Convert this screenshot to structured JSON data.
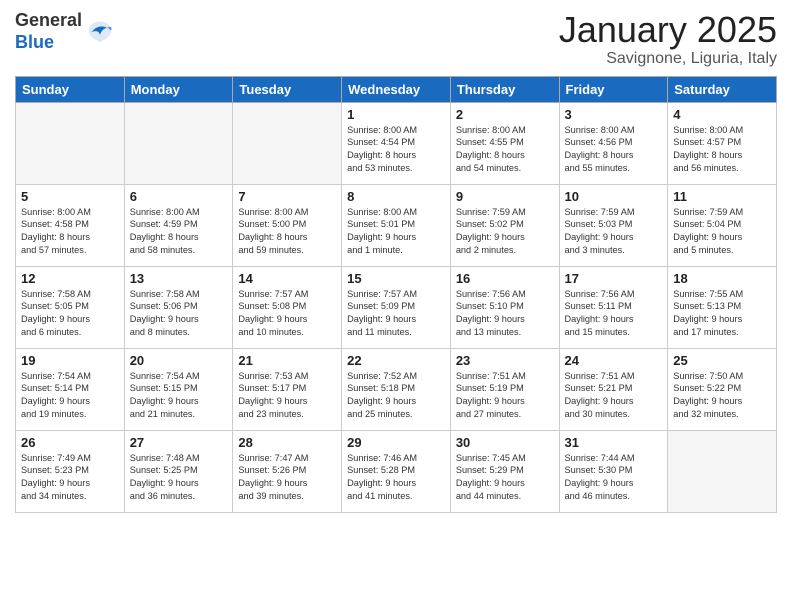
{
  "header": {
    "logo_general": "General",
    "logo_blue": "Blue",
    "month_title": "January 2025",
    "location": "Savignone, Liguria, Italy"
  },
  "weekdays": [
    "Sunday",
    "Monday",
    "Tuesday",
    "Wednesday",
    "Thursday",
    "Friday",
    "Saturday"
  ],
  "weeks": [
    [
      {
        "day": "",
        "info": ""
      },
      {
        "day": "",
        "info": ""
      },
      {
        "day": "",
        "info": ""
      },
      {
        "day": "1",
        "info": "Sunrise: 8:00 AM\nSunset: 4:54 PM\nDaylight: 8 hours\nand 53 minutes."
      },
      {
        "day": "2",
        "info": "Sunrise: 8:00 AM\nSunset: 4:55 PM\nDaylight: 8 hours\nand 54 minutes."
      },
      {
        "day": "3",
        "info": "Sunrise: 8:00 AM\nSunset: 4:56 PM\nDaylight: 8 hours\nand 55 minutes."
      },
      {
        "day": "4",
        "info": "Sunrise: 8:00 AM\nSunset: 4:57 PM\nDaylight: 8 hours\nand 56 minutes."
      }
    ],
    [
      {
        "day": "5",
        "info": "Sunrise: 8:00 AM\nSunset: 4:58 PM\nDaylight: 8 hours\nand 57 minutes."
      },
      {
        "day": "6",
        "info": "Sunrise: 8:00 AM\nSunset: 4:59 PM\nDaylight: 8 hours\nand 58 minutes."
      },
      {
        "day": "7",
        "info": "Sunrise: 8:00 AM\nSunset: 5:00 PM\nDaylight: 8 hours\nand 59 minutes."
      },
      {
        "day": "8",
        "info": "Sunrise: 8:00 AM\nSunset: 5:01 PM\nDaylight: 9 hours\nand 1 minute."
      },
      {
        "day": "9",
        "info": "Sunrise: 7:59 AM\nSunset: 5:02 PM\nDaylight: 9 hours\nand 2 minutes."
      },
      {
        "day": "10",
        "info": "Sunrise: 7:59 AM\nSunset: 5:03 PM\nDaylight: 9 hours\nand 3 minutes."
      },
      {
        "day": "11",
        "info": "Sunrise: 7:59 AM\nSunset: 5:04 PM\nDaylight: 9 hours\nand 5 minutes."
      }
    ],
    [
      {
        "day": "12",
        "info": "Sunrise: 7:58 AM\nSunset: 5:05 PM\nDaylight: 9 hours\nand 6 minutes."
      },
      {
        "day": "13",
        "info": "Sunrise: 7:58 AM\nSunset: 5:06 PM\nDaylight: 9 hours\nand 8 minutes."
      },
      {
        "day": "14",
        "info": "Sunrise: 7:57 AM\nSunset: 5:08 PM\nDaylight: 9 hours\nand 10 minutes."
      },
      {
        "day": "15",
        "info": "Sunrise: 7:57 AM\nSunset: 5:09 PM\nDaylight: 9 hours\nand 11 minutes."
      },
      {
        "day": "16",
        "info": "Sunrise: 7:56 AM\nSunset: 5:10 PM\nDaylight: 9 hours\nand 13 minutes."
      },
      {
        "day": "17",
        "info": "Sunrise: 7:56 AM\nSunset: 5:11 PM\nDaylight: 9 hours\nand 15 minutes."
      },
      {
        "day": "18",
        "info": "Sunrise: 7:55 AM\nSunset: 5:13 PM\nDaylight: 9 hours\nand 17 minutes."
      }
    ],
    [
      {
        "day": "19",
        "info": "Sunrise: 7:54 AM\nSunset: 5:14 PM\nDaylight: 9 hours\nand 19 minutes."
      },
      {
        "day": "20",
        "info": "Sunrise: 7:54 AM\nSunset: 5:15 PM\nDaylight: 9 hours\nand 21 minutes."
      },
      {
        "day": "21",
        "info": "Sunrise: 7:53 AM\nSunset: 5:17 PM\nDaylight: 9 hours\nand 23 minutes."
      },
      {
        "day": "22",
        "info": "Sunrise: 7:52 AM\nSunset: 5:18 PM\nDaylight: 9 hours\nand 25 minutes."
      },
      {
        "day": "23",
        "info": "Sunrise: 7:51 AM\nSunset: 5:19 PM\nDaylight: 9 hours\nand 27 minutes."
      },
      {
        "day": "24",
        "info": "Sunrise: 7:51 AM\nSunset: 5:21 PM\nDaylight: 9 hours\nand 30 minutes."
      },
      {
        "day": "25",
        "info": "Sunrise: 7:50 AM\nSunset: 5:22 PM\nDaylight: 9 hours\nand 32 minutes."
      }
    ],
    [
      {
        "day": "26",
        "info": "Sunrise: 7:49 AM\nSunset: 5:23 PM\nDaylight: 9 hours\nand 34 minutes."
      },
      {
        "day": "27",
        "info": "Sunrise: 7:48 AM\nSunset: 5:25 PM\nDaylight: 9 hours\nand 36 minutes."
      },
      {
        "day": "28",
        "info": "Sunrise: 7:47 AM\nSunset: 5:26 PM\nDaylight: 9 hours\nand 39 minutes."
      },
      {
        "day": "29",
        "info": "Sunrise: 7:46 AM\nSunset: 5:28 PM\nDaylight: 9 hours\nand 41 minutes."
      },
      {
        "day": "30",
        "info": "Sunrise: 7:45 AM\nSunset: 5:29 PM\nDaylight: 9 hours\nand 44 minutes."
      },
      {
        "day": "31",
        "info": "Sunrise: 7:44 AM\nSunset: 5:30 PM\nDaylight: 9 hours\nand 46 minutes."
      },
      {
        "day": "",
        "info": ""
      }
    ]
  ]
}
